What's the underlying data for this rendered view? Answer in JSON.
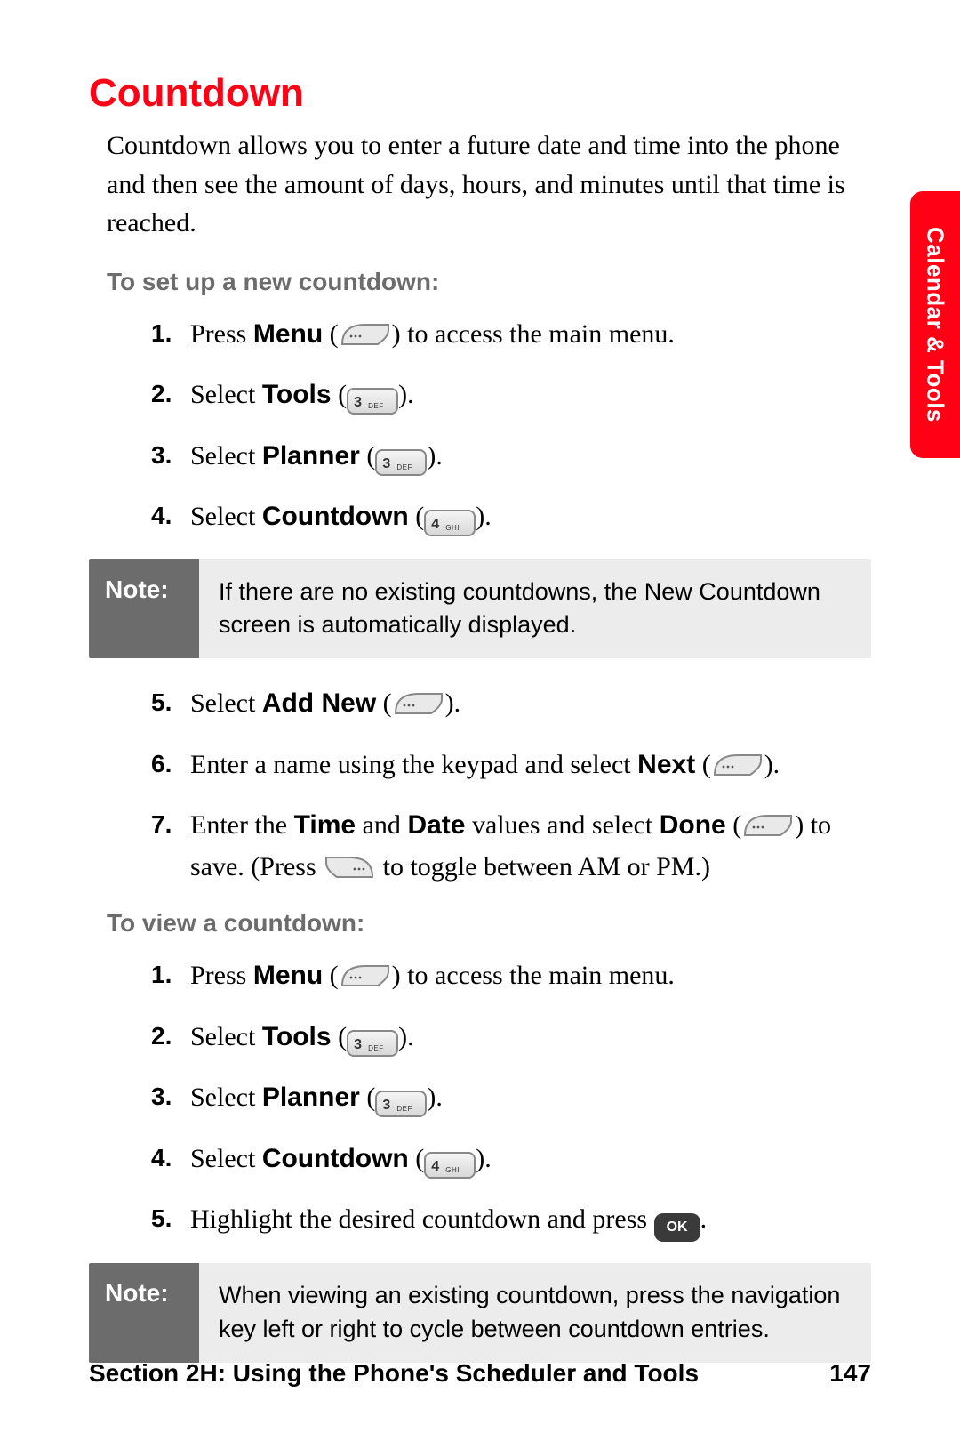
{
  "sideTab": "Calendar & Tools",
  "title": "Countdown",
  "intro": "Countdown allows you to enter a future date and time into the phone and then see the amount of days, hours, and minutes until that time is reached.",
  "subhead1": "To set up a new countdown:",
  "steps1": {
    "s1_pre": "Press ",
    "s1_bold": "Menu",
    "s1_post": " to access the main menu.",
    "s2_pre": "Select ",
    "s2_bold": "Tools",
    "s3_pre": "Select ",
    "s3_bold": "Planner",
    "s4_pre": "Select ",
    "s4_bold": "Countdown"
  },
  "note1_label": "Note:",
  "note1_body": "If there are no existing countdowns, the New Countdown screen is automatically displayed.",
  "steps1b": {
    "s5_pre": "Select ",
    "s5_bold": "Add New",
    "s6_pre": "Enter a name using the keypad and select ",
    "s6_bold": "Next",
    "s7_a": "Enter the ",
    "s7_b1": "Time",
    "s7_b": " and ",
    "s7_b2": "Date",
    "s7_c": " values and select ",
    "s7_b3": "Done",
    "s7_d_pre": " to save. (Press ",
    "s7_d_post": " to toggle between AM or PM.)"
  },
  "subhead2": "To view a countdown:",
  "steps2": {
    "s1_pre": "Press ",
    "s1_bold": "Menu",
    "s1_post": " to access the main menu.",
    "s2_pre": "Select ",
    "s2_bold": "Tools",
    "s3_pre": "Select ",
    "s3_bold": "Planner",
    "s4_pre": "Select ",
    "s4_bold": "Countdown",
    "s5": "Highlight the desired countdown and press "
  },
  "note2_label": "Note:",
  "note2_body": "When viewing an existing countdown, press the navigation key left or right to cycle between countdown entries.",
  "footer_left": "Section 2H: Using the Phone's Scheduler and Tools",
  "footer_right": "147",
  "keys": {
    "key3_sub": "DEF",
    "key4_sub": "GHI",
    "ok": "OK"
  }
}
